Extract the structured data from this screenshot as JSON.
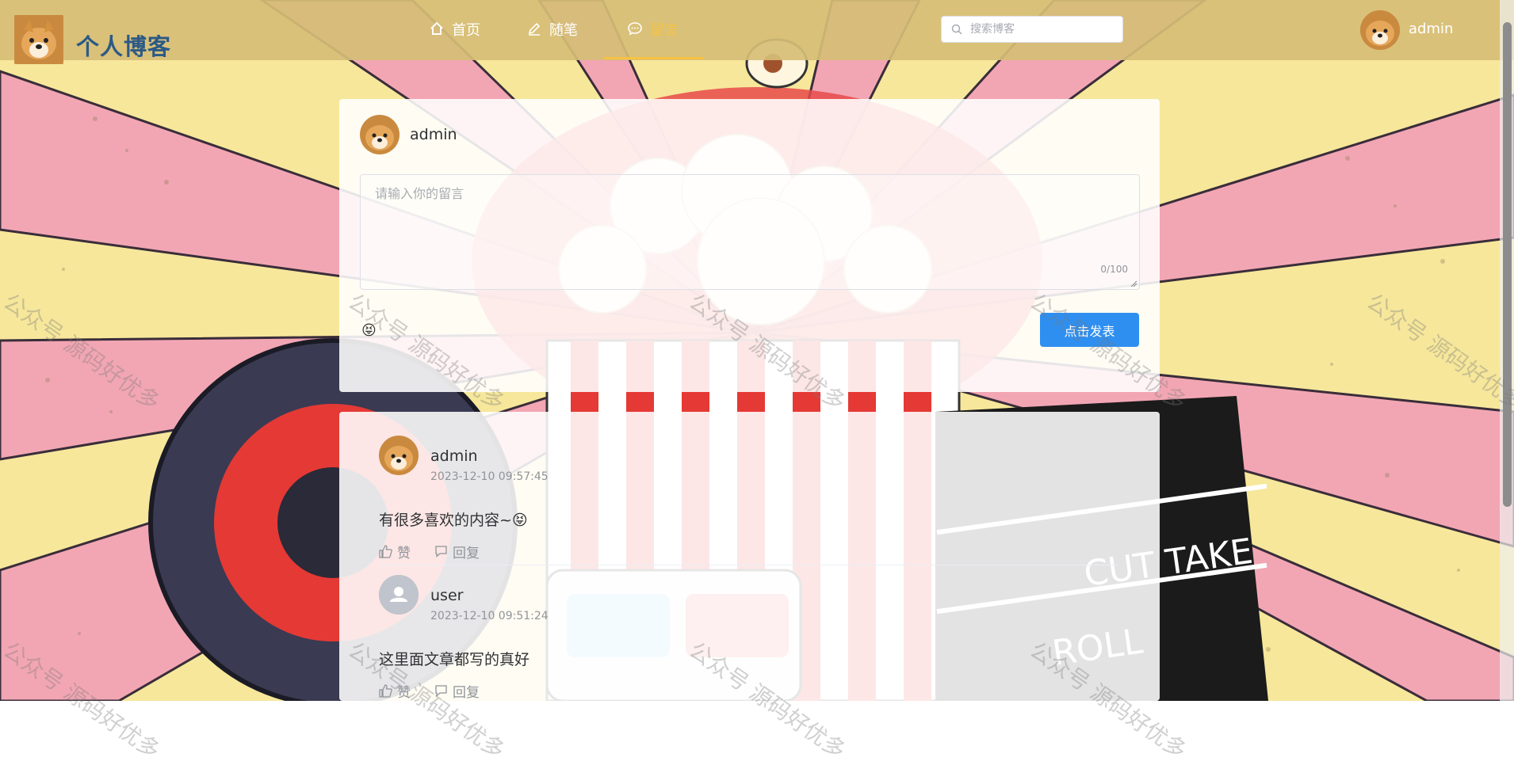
{
  "header": {
    "site_title": "个人博客",
    "nav": [
      {
        "label": "首页",
        "icon": "home-icon"
      },
      {
        "label": "随笔",
        "icon": "edit-icon"
      },
      {
        "label": "留言",
        "icon": "chat-icon",
        "active": true
      }
    ],
    "search_placeholder": "搜索博客",
    "user_name": "admin"
  },
  "composer": {
    "user_name": "admin",
    "placeholder": "请输入你的留言",
    "counter": "0/100",
    "emoji": "😝",
    "submit_label": "点击发表"
  },
  "comments": [
    {
      "user": "admin",
      "time": "2023-12-10 09:57:45",
      "text": "有很多喜欢的内容~",
      "emoji": "😝",
      "like_label": "赞",
      "reply_label": "回复"
    },
    {
      "user": "user",
      "time": "2023-12-10 09:51:24",
      "text": "这里面文章都写的真好",
      "like_label": "赞",
      "reply_label": "回复"
    }
  ],
  "watermark": "公众号 源码好优多",
  "colors": {
    "accent": "#f7c244",
    "title": "#2c5a86",
    "button": "#2f8ff0",
    "header_bg": "#d6be76"
  }
}
